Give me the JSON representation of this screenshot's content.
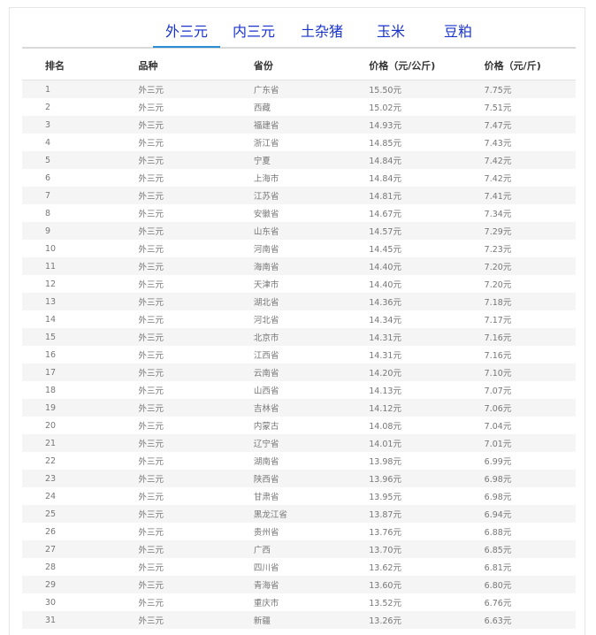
{
  "tabs": [
    {
      "label": "外三元",
      "active": true
    },
    {
      "label": "内三元",
      "active": false
    },
    {
      "label": "土杂猪",
      "active": false
    },
    {
      "label": "玉米",
      "active": false
    },
    {
      "label": "豆粕",
      "active": false
    }
  ],
  "table": {
    "headers": [
      "排名",
      "品种",
      "省份",
      "价格（元/公斤)",
      "价格（元/斤)"
    ],
    "rows": [
      [
        "1",
        "外三元",
        "广东省",
        "15.50元",
        "7.75元"
      ],
      [
        "2",
        "外三元",
        "西藏",
        "15.02元",
        "7.51元"
      ],
      [
        "3",
        "外三元",
        "福建省",
        "14.93元",
        "7.47元"
      ],
      [
        "4",
        "外三元",
        "浙江省",
        "14.85元",
        "7.43元"
      ],
      [
        "5",
        "外三元",
        "宁夏",
        "14.84元",
        "7.42元"
      ],
      [
        "6",
        "外三元",
        "上海市",
        "14.84元",
        "7.42元"
      ],
      [
        "7",
        "外三元",
        "江苏省",
        "14.81元",
        "7.41元"
      ],
      [
        "8",
        "外三元",
        "安徽省",
        "14.67元",
        "7.34元"
      ],
      [
        "9",
        "外三元",
        "山东省",
        "14.57元",
        "7.29元"
      ],
      [
        "10",
        "外三元",
        "河南省",
        "14.45元",
        "7.23元"
      ],
      [
        "11",
        "外三元",
        "海南省",
        "14.40元",
        "7.20元"
      ],
      [
        "12",
        "外三元",
        "天津市",
        "14.40元",
        "7.20元"
      ],
      [
        "13",
        "外三元",
        "湖北省",
        "14.36元",
        "7.18元"
      ],
      [
        "14",
        "外三元",
        "河北省",
        "14.34元",
        "7.17元"
      ],
      [
        "15",
        "外三元",
        "北京市",
        "14.31元",
        "7.16元"
      ],
      [
        "16",
        "外三元",
        "江西省",
        "14.31元",
        "7.16元"
      ],
      [
        "17",
        "外三元",
        "云南省",
        "14.20元",
        "7.10元"
      ],
      [
        "18",
        "外三元",
        "山西省",
        "14.13元",
        "7.07元"
      ],
      [
        "19",
        "外三元",
        "吉林省",
        "14.12元",
        "7.06元"
      ],
      [
        "20",
        "外三元",
        "内蒙古",
        "14.08元",
        "7.04元"
      ],
      [
        "21",
        "外三元",
        "辽宁省",
        "14.01元",
        "7.01元"
      ],
      [
        "22",
        "外三元",
        "湖南省",
        "13.98元",
        "6.99元"
      ],
      [
        "23",
        "外三元",
        "陕西省",
        "13.96元",
        "6.98元"
      ],
      [
        "24",
        "外三元",
        "甘肃省",
        "13.95元",
        "6.98元"
      ],
      [
        "25",
        "外三元",
        "黑龙江省",
        "13.87元",
        "6.94元"
      ],
      [
        "26",
        "外三元",
        "贵州省",
        "13.76元",
        "6.88元"
      ],
      [
        "27",
        "外三元",
        "广西",
        "13.70元",
        "6.85元"
      ],
      [
        "28",
        "外三元",
        "四川省",
        "13.62元",
        "6.81元"
      ],
      [
        "29",
        "外三元",
        "青海省",
        "13.60元",
        "6.80元"
      ],
      [
        "30",
        "外三元",
        "重庆市",
        "13.52元",
        "6.76元"
      ],
      [
        "31",
        "外三元",
        "新疆",
        "13.26元",
        "6.63元"
      ]
    ]
  }
}
